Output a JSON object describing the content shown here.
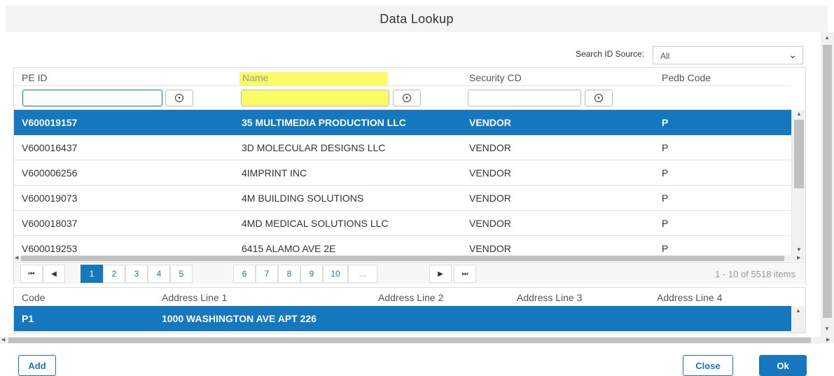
{
  "dialog": {
    "title": "Data Lookup"
  },
  "search_source": {
    "label": "Search ID Source:",
    "selected": "All"
  },
  "grid": {
    "columns": [
      "PE ID",
      "Name",
      "Security CD",
      "Pedb Code"
    ],
    "filters": {
      "pe_id": "",
      "name": "",
      "security_cd": ""
    },
    "rows": [
      {
        "pe_id": "V600019157",
        "name": "35 MULTIMEDIA PRODUCTION LLC",
        "security_cd": "VENDOR",
        "pedb_code": "P"
      },
      {
        "pe_id": "V600016437",
        "name": "3D MOLECULAR DESIGNS LLC",
        "security_cd": "VENDOR",
        "pedb_code": "P"
      },
      {
        "pe_id": "V600006256",
        "name": "4IMPRINT INC",
        "security_cd": "VENDOR",
        "pedb_code": "P"
      },
      {
        "pe_id": "V600019073",
        "name": "4M BUILDING SOLUTIONS",
        "security_cd": "VENDOR",
        "pedb_code": "P"
      },
      {
        "pe_id": "V600018037",
        "name": "4MD MEDICAL SOLUTIONS LLC",
        "security_cd": "VENDOR",
        "pedb_code": "P"
      },
      {
        "pe_id": "V600019253",
        "name": "6415 ALAMO AVE 2E",
        "security_cd": "VENDOR",
        "pedb_code": "P"
      }
    ]
  },
  "pager": {
    "pages": [
      "1",
      "2",
      "3",
      "4",
      "5",
      "6",
      "7",
      "8",
      "9",
      "10",
      "..."
    ],
    "current": "1",
    "info": "1 - 10 of 5518 items"
  },
  "address_grid": {
    "columns": [
      "Code",
      "Address Line 1",
      "Address Line 2",
      "Address Line 3",
      "Address Line 4"
    ],
    "rows": [
      {
        "code": "P1",
        "line1": "1000 WASHINGTON AVE APT 226",
        "line2": "",
        "line3": "",
        "line4": ""
      }
    ]
  },
  "buttons": {
    "add": "Add",
    "close": "Close",
    "ok": "Ok"
  },
  "colors": {
    "accent": "#1578bf",
    "highlight": "#fbfb63"
  }
}
